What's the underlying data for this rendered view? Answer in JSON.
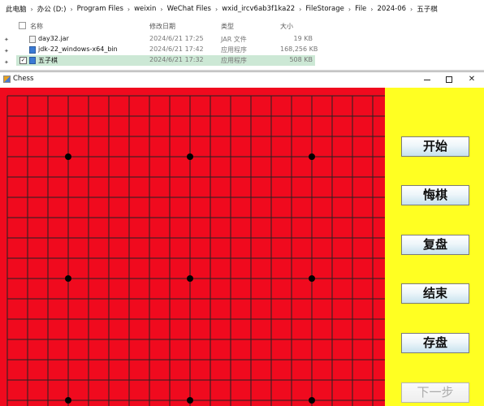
{
  "explorer": {
    "breadcrumb": [
      "此电脑",
      "办公 (D:)",
      "Program Files",
      "weixin",
      "WeChat Files",
      "wxid_ircv6ab3f1ka22",
      "FileStorage",
      "File",
      "2024-06",
      "五子棋"
    ],
    "columns": {
      "name": "名称",
      "date": "修改日期",
      "type": "类型",
      "size": "大小"
    },
    "files": [
      {
        "name": "day32.jar",
        "date": "2024/6/21 17:25",
        "type": "JAR 文件",
        "size": "19 KB",
        "selected": false
      },
      {
        "name": "jdk-22_windows-x64_bin",
        "date": "2024/6/21 17:42",
        "type": "应用程序",
        "size": "168,256 KB",
        "selected": false
      },
      {
        "name": "五子棋",
        "date": "2024/6/21 17:32",
        "type": "应用程序",
        "size": "508 KB",
        "selected": true
      }
    ]
  },
  "window": {
    "title": "Chess",
    "close_glyph": "✕"
  },
  "board": {
    "background": "#f00a1e",
    "line_color": "#222222",
    "star_color": "#000000",
    "star_points": [
      [
        3,
        3
      ],
      [
        9,
        3
      ],
      [
        15,
        3
      ],
      [
        3,
        9
      ],
      [
        9,
        9
      ],
      [
        15,
        9
      ],
      [
        3,
        15
      ],
      [
        9,
        15
      ],
      [
        15,
        15
      ]
    ]
  },
  "panel": {
    "background": "#ffff22",
    "buttons": [
      {
        "label": "开始",
        "enabled": true
      },
      {
        "label": "悔棋",
        "enabled": true
      },
      {
        "label": "复盘",
        "enabled": true
      },
      {
        "label": "结束",
        "enabled": true
      },
      {
        "label": "存盘",
        "enabled": true
      },
      {
        "label": "下一步",
        "enabled": false
      }
    ]
  }
}
